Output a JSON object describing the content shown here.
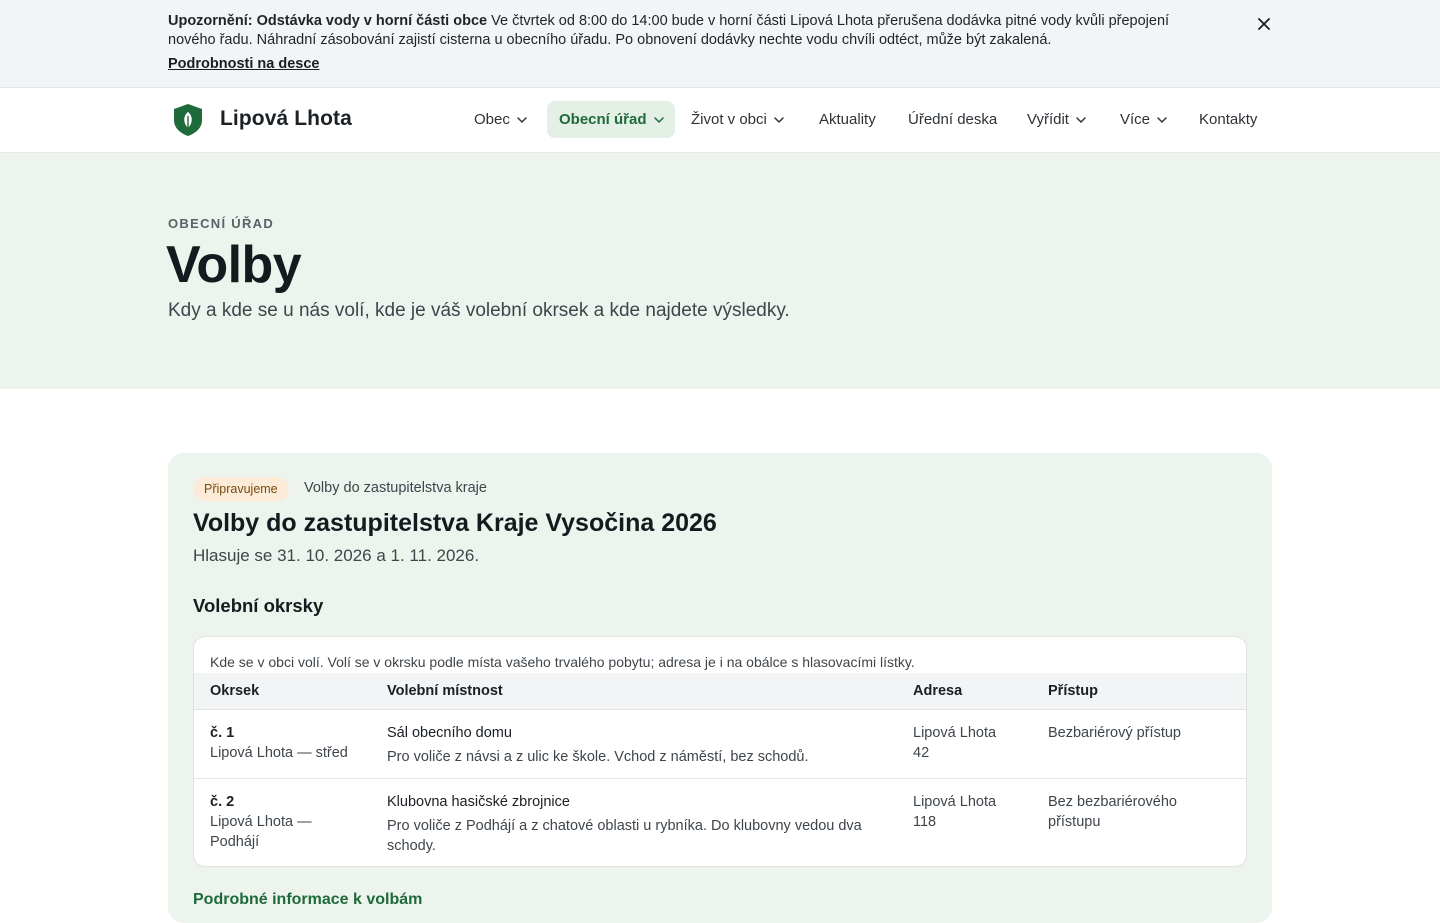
{
  "alert": {
    "title": "Upozornění: Odstávka vody v horní části obce",
    "text": " Ve čtvrtek od 8:00 do 14:00 bude v horní části Lipová Lhota přerušena dodávka pitné vody kvůli přepojení nového řadu. Náhradní zásobování zajistí cisterna u obecního úřadu. Po obnovení dodávky nechte vodu chvíli odtéct, může být zakalená.",
    "link": "Podrobnosti na desce",
    "close_icon": "close-icon"
  },
  "header": {
    "brand": "Lipová Lhota",
    "logo_icon": "shield-leaf-icon",
    "nav": [
      {
        "label": "Obec",
        "dropdown": true
      },
      {
        "label": "Obecní úřad",
        "dropdown": true,
        "active": true
      },
      {
        "label": "Život v obci",
        "dropdown": true
      },
      {
        "label": "Aktuality",
        "dropdown": false
      },
      {
        "label": "Úřední deska",
        "dropdown": false
      },
      {
        "label": "Vyřídit",
        "dropdown": true
      },
      {
        "label": "Více",
        "dropdown": true
      },
      {
        "label": "Kontakty",
        "dropdown": false
      }
    ]
  },
  "hero": {
    "eyebrow": "OBECNÍ ÚŘAD",
    "title": "Volby",
    "lead": "Kdy a kde se u nás volí, kde je váš volební okrsek a kde najdete výsledky."
  },
  "election": {
    "badge": "Připravujeme",
    "type": "Volby do zastupitelstva kraje",
    "title": "Volby do zastupitelstva Kraje Vysočina 2026",
    "date": "Hlasuje se 31. 10. 2026 a 1. 11. 2026.",
    "section_title": "Volební okrsky",
    "table": {
      "caption": "Kde se v obci volí. Volí se v okrsku podle místa vašeho trvalého pobytu; adresa je i na obálce s hlasovacími lístky.",
      "headers": [
        "Okrsek",
        "Volební místnost",
        "Adresa",
        "Přístup"
      ],
      "rows": [
        {
          "district": "č. 1",
          "district_name": "Lipová Lhota — střed",
          "room": "Sál obecního domu",
          "room_note": "Pro voliče z návsi a z ulic ke škole. Vchod z náměstí, bez schodů.",
          "address": "Lipová Lhota 42",
          "access": "Bezbariérový přístup"
        },
        {
          "district": "č. 2",
          "district_name": "Lipová Lhota — Podhájí",
          "room": "Klubovna hasičské zbrojnice",
          "room_note": "Pro voliče z Podhájí a z chatové oblasti u rybníka. Do klubovny vedou dva schody.",
          "address": "Lipová Lhota 118",
          "access": "Bez bezbariérového přístupu"
        }
      ]
    },
    "more_link": "Podrobné informace k volbám"
  },
  "colors": {
    "accent": "#1f6a3a",
    "hero_bg": "#edf4ee",
    "badge_bg": "#fbebd7",
    "alert_bg": "#f3f4f5"
  }
}
